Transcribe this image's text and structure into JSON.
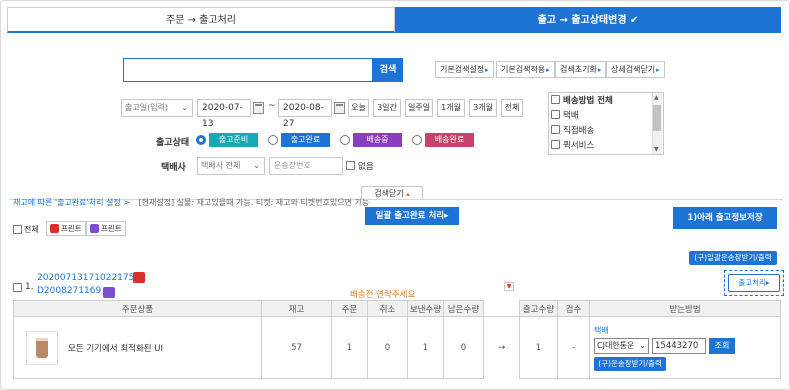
{
  "tabs": {
    "left": "주문 → 출고처리",
    "right": "출고 → 출고상태변경",
    "right_check": "✔"
  },
  "search": {
    "value": "",
    "button": "검색",
    "options": [
      "기본검색설정",
      "기본검색적용",
      "검색초기화",
      "상세검색닫기"
    ],
    "option_arrow": "▸"
  },
  "date": {
    "type_select": "출고일(입력)",
    "from": "2020-07-13",
    "to": "2020-08-27",
    "separator": "~",
    "periods": [
      "오늘",
      "3일간",
      "일주일",
      "1개월",
      "3개월",
      "전체"
    ]
  },
  "shipping": {
    "header": "배송방법 전체",
    "items": [
      "택배",
      "직접배송",
      "퀵서비스"
    ]
  },
  "status": {
    "label": "출고상태",
    "options": [
      {
        "label": "출고준비",
        "color": "#17a8b3",
        "checked": true
      },
      {
        "label": "출고완료",
        "color": "#1e74d4",
        "checked": false
      },
      {
        "label": "배송중",
        "color": "#8a3dbf",
        "checked": false
      },
      {
        "label": "배송완료",
        "color": "#c8426b",
        "checked": false
      }
    ]
  },
  "courier": {
    "label": "택배사",
    "select": "택배사 전체",
    "tracking_placeholder": "운송장번호",
    "none_label": "없음"
  },
  "fold": {
    "label": "검색닫기",
    "arrow": "▴"
  },
  "info": {
    "link": "재고에 따른 '출고완료'처리 설정 >",
    "text": "[현재설정] 실물: 재고있을때 가능.  티켓: 재고와 티켓번호있으면 가능"
  },
  "actions": {
    "bulk_complete": "일괄 출고완료 처리▸",
    "save_below": "1)아래 출고정보저장"
  },
  "print": {
    "all_label": "전체",
    "buttons": [
      "프린트",
      "프린트"
    ]
  },
  "order": {
    "index": "1.",
    "order_no": "20200713171022175 31",
    "order_no_display": "2020071317102217531",
    "release_no": "D2008271169",
    "memo": "배송전 연락주세요",
    "btn_waybill_bulk": "(구)일괄운송장받기/출력",
    "btn_release": "출고처리▸"
  },
  "table": {
    "headers": [
      "주문상품",
      "재고",
      "주문",
      "취소",
      "보낸수량",
      "남은수량",
      "",
      "출고수량",
      "검수",
      "받는방법"
    ],
    "row": {
      "product": "모든 기기에서 최적화된 UI",
      "stock": "57",
      "ordered": "1",
      "cancelled": "0",
      "sent": "1",
      "remaining": "0",
      "arrow": "→",
      "release_qty": "1",
      "inspect": "-",
      "method": "택배",
      "courier": "CJ대한통운",
      "tracking": "15443270",
      "lookup": "조회",
      "waybill_btn": "(구)운송장받기/출력"
    }
  },
  "colors": {
    "primary": "#1e74d4",
    "memo": "#e57c2a"
  }
}
